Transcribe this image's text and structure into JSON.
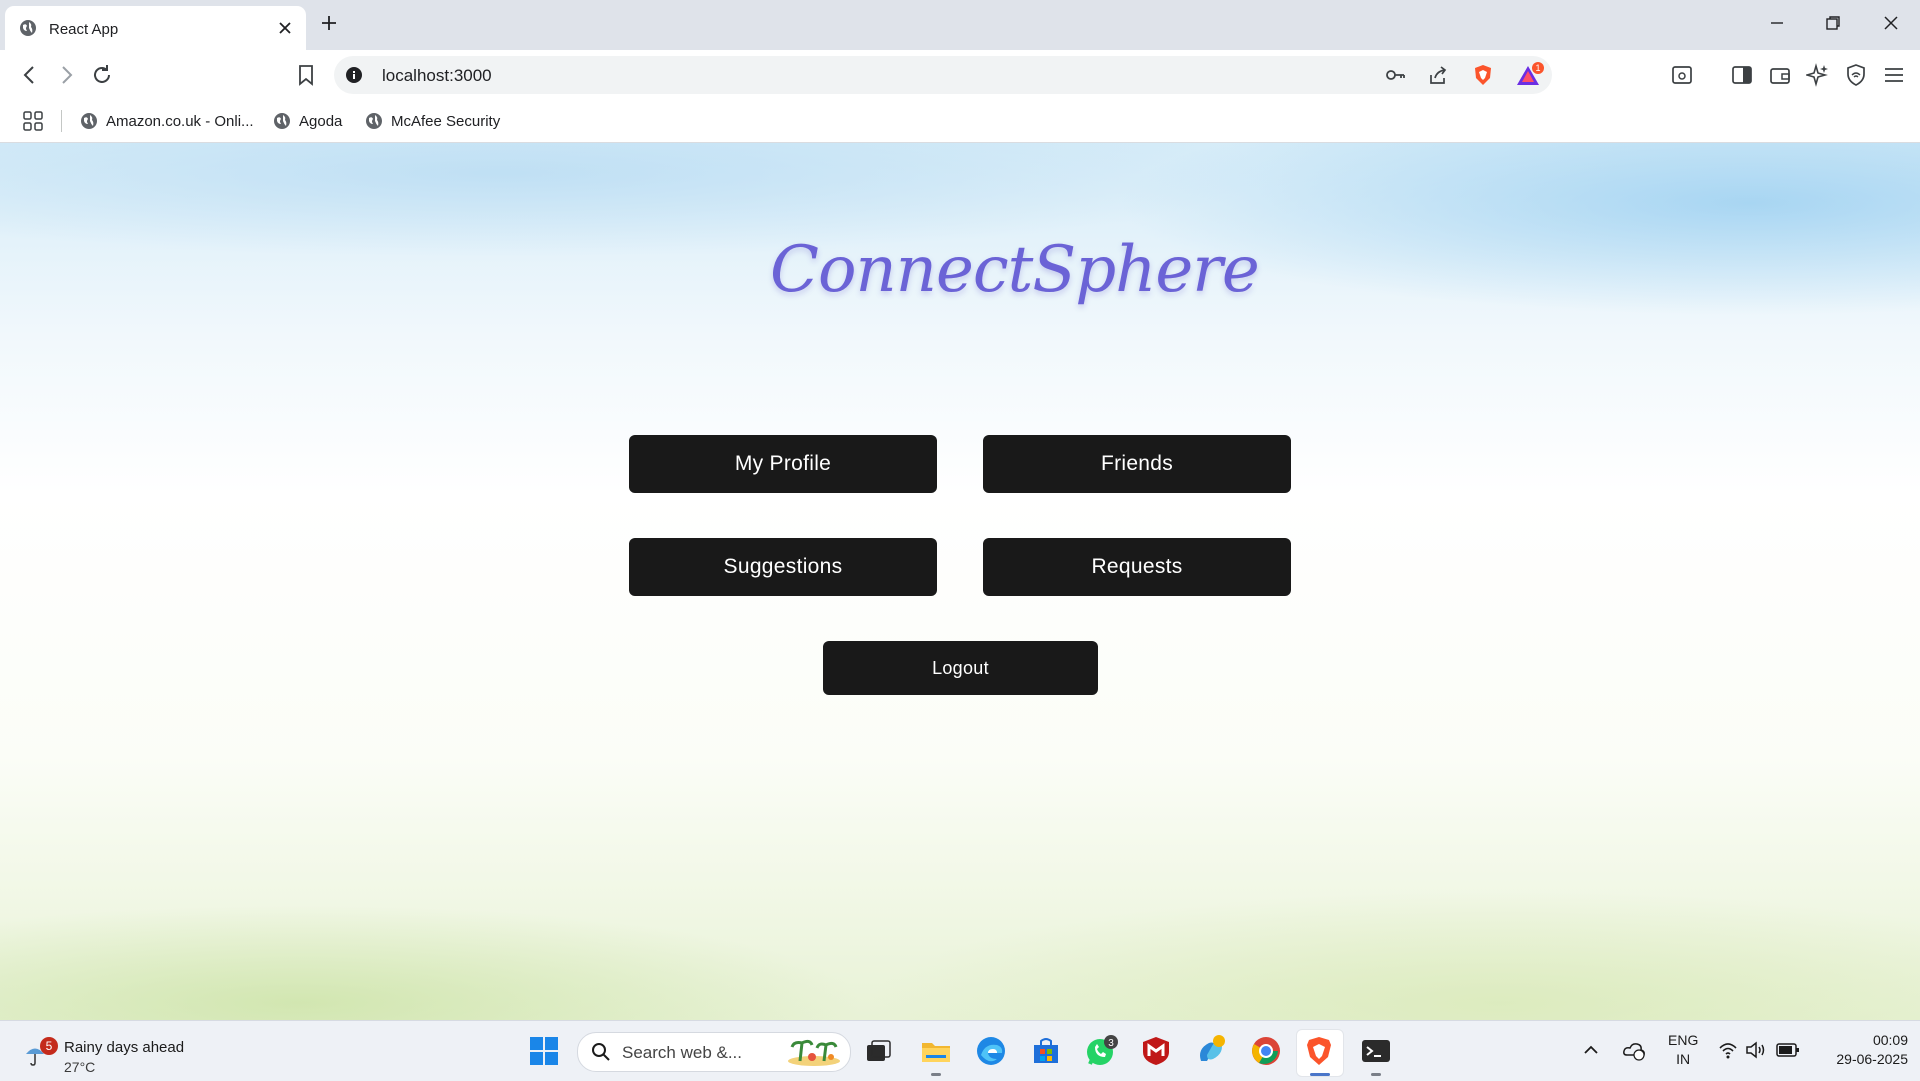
{
  "browser": {
    "tab_title": "React App",
    "url": "localhost:3000",
    "rewards_badge": "1",
    "bookmarks": [
      {
        "label": "Amazon.co.uk - Onli..."
      },
      {
        "label": "Agoda"
      },
      {
        "label": "McAfee Security"
      }
    ],
    "accent_colors": {
      "brave_orange": "#fb542b",
      "rewards_purple": "#6b2ee3"
    }
  },
  "page": {
    "logo_text": "ConnectSphere",
    "logo_color": "#6b63d6",
    "buttons": {
      "my_profile": "My Profile",
      "friends": "Friends",
      "suggestions": "Suggestions",
      "requests": "Requests",
      "logout": "Logout"
    },
    "button_color": "#191919"
  },
  "taskbar": {
    "weather": {
      "badge": "5",
      "title": "Rainy days ahead",
      "temp": "27°C"
    },
    "search_placeholder": "Search web &...",
    "whatsapp_badge": "3",
    "language": {
      "line1": "ENG",
      "line2": "IN"
    },
    "clock": {
      "time": "00:09",
      "date": "29-06-2025"
    },
    "apps": [
      "windows-start",
      "search",
      "task-view",
      "file-explorer",
      "edge",
      "microsoft-store",
      "whatsapp",
      "mcafee",
      "copilot",
      "chrome",
      "brave",
      "terminal"
    ]
  }
}
